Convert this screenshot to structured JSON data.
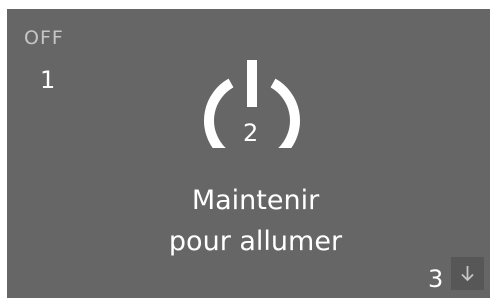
{
  "status": {
    "label": "OFF"
  },
  "callouts": {
    "one": "1",
    "two": "2",
    "three": "3"
  },
  "power": {
    "icon": "power-icon",
    "instruction_line1": "Maintenir",
    "instruction_line2": "pour allumer"
  },
  "scroll": {
    "icon": "arrow-down-icon"
  },
  "colors": {
    "screen_background": "#666666",
    "status_text": "#c6c6c6",
    "foreground": "#ffffff",
    "scroll_button_background": "#575757"
  }
}
